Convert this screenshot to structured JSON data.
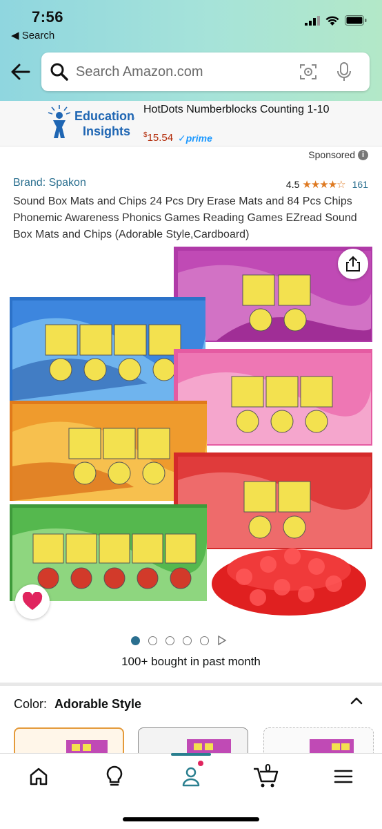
{
  "status_bar": {
    "time": "7:56",
    "back_app": "Search"
  },
  "search": {
    "placeholder": "Search Amazon.com"
  },
  "ad": {
    "brand_logo_text": "Educational Insights",
    "title": "HotDots Numberblocks Counting 1-10",
    "price_currency": "$",
    "price": "15.54",
    "prime_label": "✓prime",
    "sponsored_label": "Sponsored"
  },
  "product": {
    "brand": "Brand: Spakon",
    "rating": "4.5",
    "stars": "★★★★☆",
    "review_count": "161",
    "title": "Sound Box Mats and Chips 24 Pcs Dry Erase Mats and 84 Pcs Chips Phonemic Awareness Phonics Games Reading Games EZread Sound Box Mats and Chips (Adorable Style,Cardboard)",
    "image_count": 6,
    "active_image": 0,
    "bought_text": "100+ bought in past month"
  },
  "color": {
    "label": "Color:",
    "value": "Adorable Style"
  },
  "tabs": {
    "cart_count": "0"
  },
  "colors": {
    "accent": "#2a6f8f",
    "star": "#de7921",
    "price": "#B12704",
    "prime": "#1a98ff"
  }
}
